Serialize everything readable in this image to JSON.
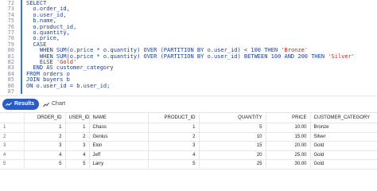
{
  "editor": {
    "lines": [
      {
        "num": "72",
        "segments": [
          {
            "t": "SELECT"
          }
        ]
      },
      {
        "num": "73",
        "segments": [
          {
            "t": "  o.order_id,"
          }
        ]
      },
      {
        "num": "74",
        "segments": [
          {
            "t": "  o.user_id,"
          }
        ]
      },
      {
        "num": "75",
        "segments": [
          {
            "t": "  b.name,"
          }
        ]
      },
      {
        "num": "76",
        "segments": [
          {
            "t": "  o.product_id,"
          }
        ]
      },
      {
        "num": "77",
        "segments": [
          {
            "t": "  o.quantity,"
          }
        ]
      },
      {
        "num": "78",
        "segments": [
          {
            "t": "  o.price,"
          }
        ]
      },
      {
        "num": "79",
        "segments": [
          {
            "t": "  CASE"
          }
        ]
      },
      {
        "num": "80",
        "segments": [
          {
            "t": "    WHEN SUM(o.price * o.quantity) OVER (PARTITION BY o.user_id) < 100 THEN "
          },
          {
            "t": "'Bronze'",
            "str": true
          }
        ]
      },
      {
        "num": "81",
        "segments": [
          {
            "t": "    WHEN SUM(o.price * o.quantity) OVER (PARTITION BY o.user_id) BETWEEN 100 AND 200 THEN "
          },
          {
            "t": "'Silver'",
            "str": true
          }
        ]
      },
      {
        "num": "82",
        "segments": [
          {
            "t": "    ELSE "
          },
          {
            "t": "'Gold'",
            "str": true
          }
        ]
      },
      {
        "num": "83",
        "segments": [
          {
            "t": "  END AS customer_category"
          }
        ]
      },
      {
        "num": "84",
        "segments": [
          {
            "t": "FROM orders o"
          }
        ]
      },
      {
        "num": "85",
        "segments": [
          {
            "t": "JOIN buyers b"
          }
        ]
      },
      {
        "num": "86",
        "segments": [
          {
            "t": "ON o.user_id = b.user_id;"
          }
        ]
      },
      {
        "num": "87",
        "segments": [
          {
            "t": ""
          }
        ]
      }
    ]
  },
  "tabs": {
    "results_label": "Results",
    "chart_label": "Chart"
  },
  "grid": {
    "columns": [
      "",
      "ORDER_ID",
      "USER_ID",
      "NAME",
      "PRODUCT_ID",
      "QUANTITY",
      "PRICE",
      "CUSTOMER_CATEGORY"
    ],
    "rows": [
      [
        "1",
        "1",
        "1",
        "Chaos",
        "1",
        "5",
        "10.00",
        "Bronze"
      ],
      [
        "2",
        "2",
        "2",
        "Genius",
        "2",
        "10",
        "15.00",
        "Silver"
      ],
      [
        "3",
        "3",
        "3",
        "Elon",
        "3",
        "15",
        "20.00",
        "Gold"
      ],
      [
        "4",
        "4",
        "4",
        "Jeff",
        "4",
        "20",
        "25.00",
        "Gold"
      ],
      [
        "5",
        "5",
        "5",
        "Larry",
        "5",
        "25",
        "30.00",
        "Gold"
      ]
    ]
  },
  "colors": {
    "accent": "#2a5cc8",
    "keyword": "#1b3f95",
    "string": "#b22a1c"
  }
}
